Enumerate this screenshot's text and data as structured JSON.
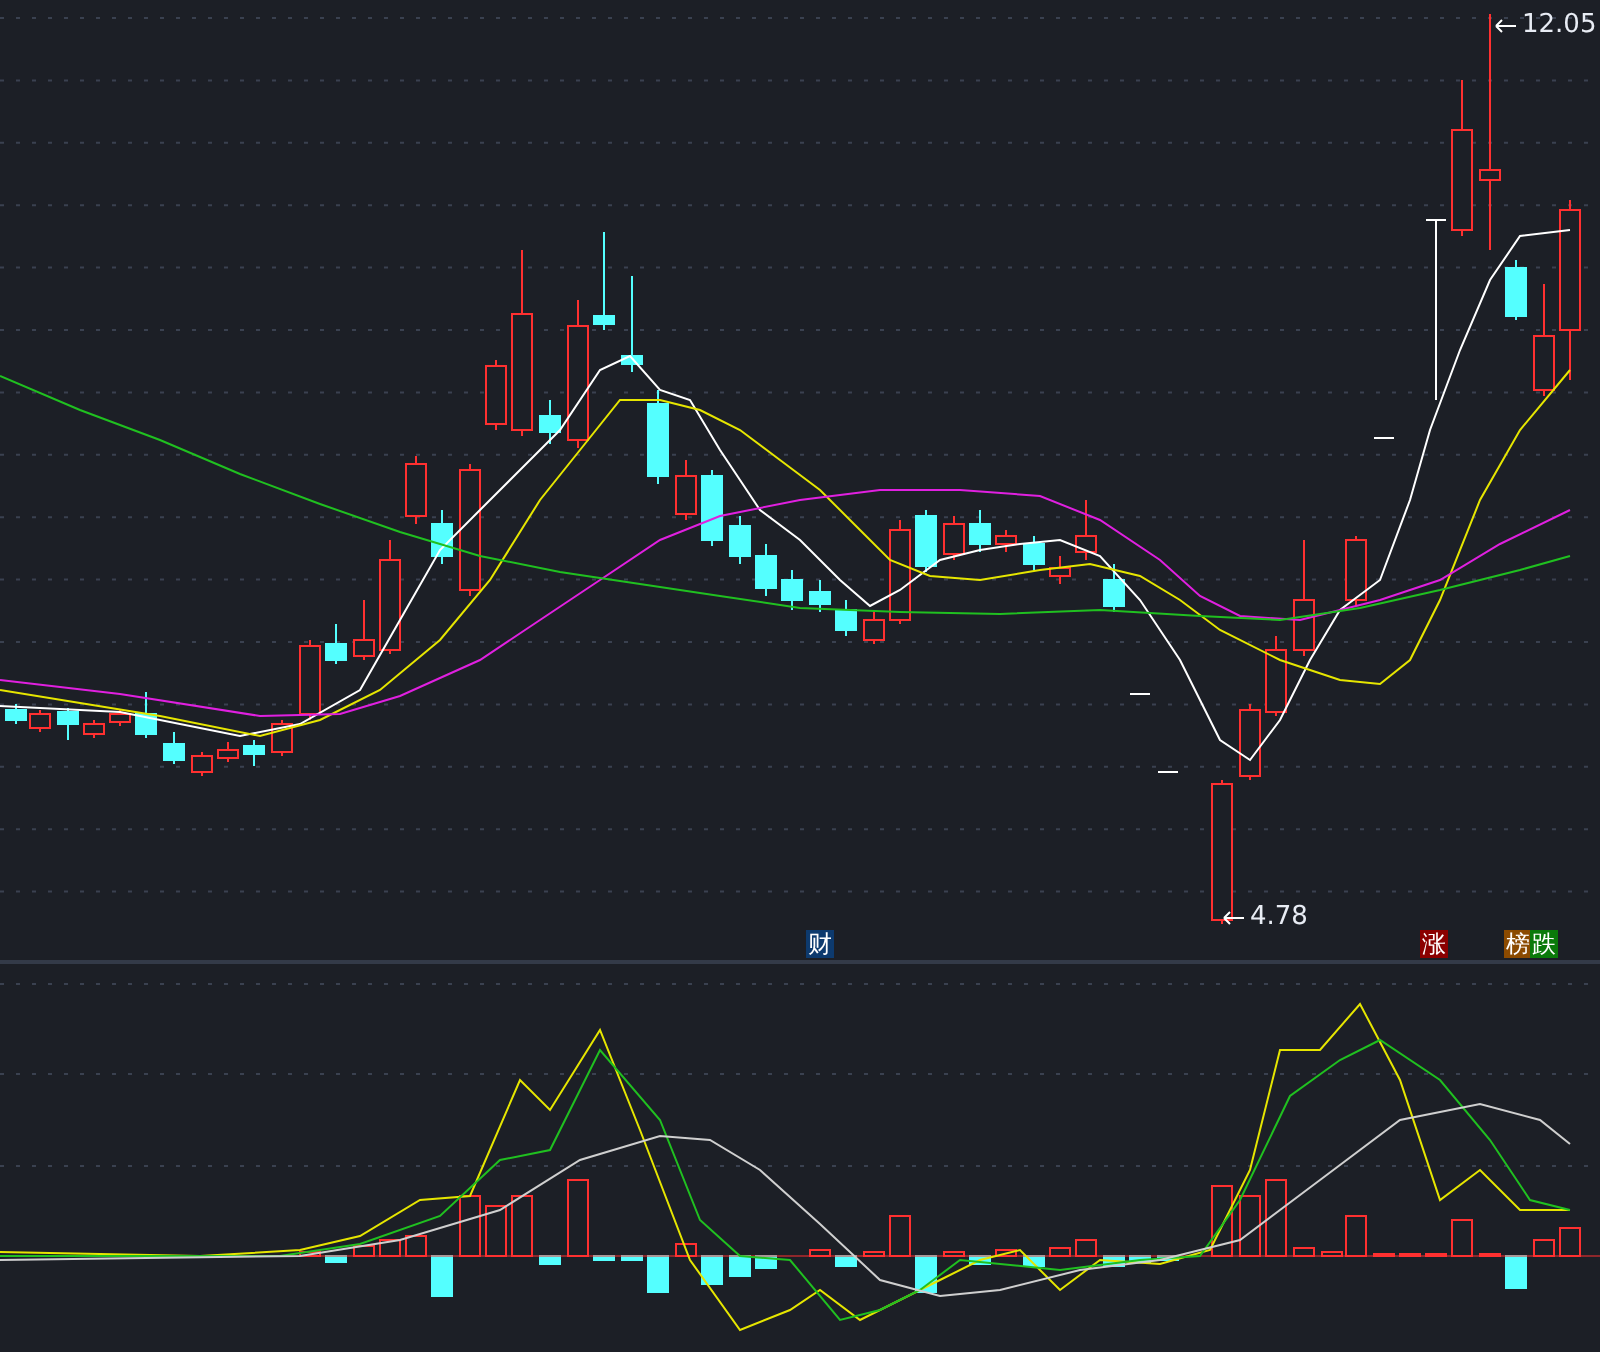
{
  "price_chart": {
    "high_label": "12.05",
    "low_label": "4.78"
  },
  "markers": [
    {
      "label": "财",
      "color": "#0d3a6e"
    }
  ],
  "badges": [
    {
      "label": "涨",
      "color": "#8b0000"
    },
    {
      "label": "榜",
      "color": "#8b4a00"
    },
    {
      "label": "跌",
      "color": "#0a7a0a"
    }
  ]
}
